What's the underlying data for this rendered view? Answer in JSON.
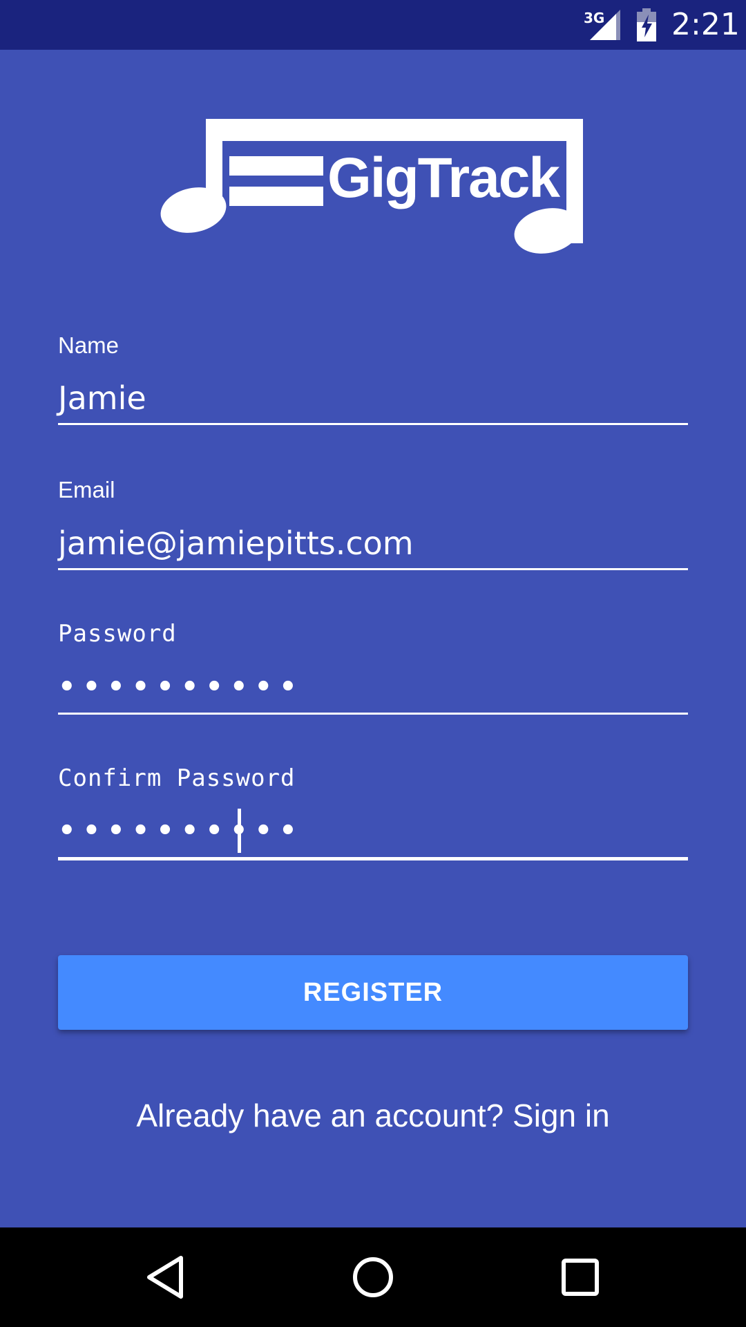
{
  "status_bar": {
    "network": "3G",
    "time": "2:21",
    "icons": [
      "signal-icon",
      "battery-charging-icon"
    ]
  },
  "logo": {
    "text": "GigTrack",
    "icon": "music-note-logo"
  },
  "form": {
    "name": {
      "label": "Name",
      "value": "Jamie"
    },
    "email": {
      "label": "Email",
      "value": "jamie@jamiepitts.com"
    },
    "password": {
      "label": "Password",
      "value": "••••••••••"
    },
    "confirm_password": {
      "label": "Confirm Password",
      "value": "••••••••••"
    }
  },
  "register_button": {
    "label": "REGISTER"
  },
  "signin_link": {
    "label": "Already have an account? Sign in"
  },
  "nav_bar": {
    "icons": [
      "back-icon",
      "home-icon",
      "recents-icon"
    ]
  },
  "colors": {
    "background": "#3F51B5",
    "status_bar": "#1A237E",
    "button": "#448AFF",
    "text": "#FFFFFF"
  }
}
